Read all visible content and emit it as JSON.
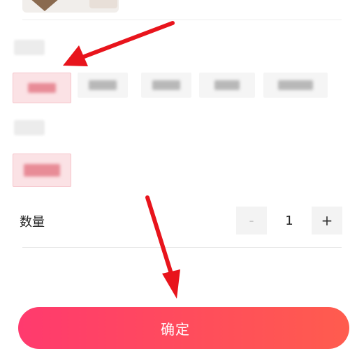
{
  "quantity": {
    "label": "数量",
    "minus_symbol": "-",
    "value": "1",
    "plus_symbol": "+"
  },
  "confirm_button": {
    "label": "确定"
  },
  "colors": {
    "accent_start": "#ff3a6e",
    "accent_end": "#ff5c4e",
    "selected_bg": "#fbe2e5",
    "annotation_arrow": "#e8141c"
  },
  "icons": {
    "arrow_1": "red-annotation-arrow-icon",
    "arrow_2": "red-annotation-arrow-icon"
  }
}
